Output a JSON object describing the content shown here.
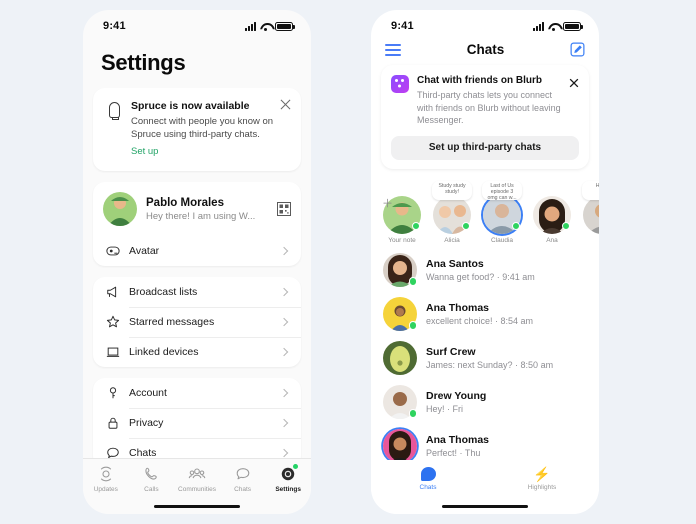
{
  "background_color": "#eef2f7",
  "accent_green": "#21a366",
  "accent_blue": "#3b7ff5",
  "online_green": "#2fd35f",
  "left_phone": {
    "status_bar": {
      "time": "9:41",
      "signal_icon": "cellular-signal-icon",
      "wifi_icon": "wifi-icon",
      "battery_icon": "battery-full-icon"
    },
    "page_title": "Settings",
    "promo_card": {
      "icon": "lightbulb-icon",
      "title": "Spruce is now available",
      "description": "Connect with people you know on Spruce using third-party chats.",
      "link_label": "Set up",
      "close_icon": "close-icon"
    },
    "profile": {
      "name": "Pablo Morales",
      "status": "Hey there! I am using W...",
      "avatar": "profile-avatar",
      "qr_icon": "qr-code-icon"
    },
    "avatar_row": {
      "label": "Avatar",
      "icon": "avatar-icon",
      "chevron": "chevron-right-icon"
    },
    "group_one": [
      {
        "label": "Broadcast lists",
        "icon": "megaphone-icon"
      },
      {
        "label": "Starred messages",
        "icon": "star-icon"
      },
      {
        "label": "Linked devices",
        "icon": "laptop-icon"
      }
    ],
    "group_two": [
      {
        "label": "Account",
        "icon": "key-icon"
      },
      {
        "label": "Privacy",
        "icon": "lock-icon"
      },
      {
        "label": "Chats",
        "icon": "chat-bubble-icon"
      }
    ],
    "tabs": [
      {
        "label": "Updates",
        "icon": "updates-icon",
        "active": false,
        "badge": false
      },
      {
        "label": "Calls",
        "icon": "phone-icon",
        "active": false,
        "badge": false
      },
      {
        "label": "Communities",
        "icon": "communities-icon",
        "active": false,
        "badge": false
      },
      {
        "label": "Chats",
        "icon": "chats-icon",
        "active": false,
        "badge": false
      },
      {
        "label": "Settings",
        "icon": "settings-icon",
        "active": true,
        "badge": true
      }
    ]
  },
  "right_phone": {
    "status_bar": {
      "time": "9:41",
      "signal_icon": "cellular-signal-icon",
      "wifi_icon": "wifi-icon",
      "battery_icon": "battery-full-icon"
    },
    "header": {
      "menu_icon": "hamburger-menu-icon",
      "title": "Chats",
      "compose_icon": "compose-icon"
    },
    "blurb_card": {
      "icon": "blurb-app-icon",
      "title": "Chat with friends on Blurb",
      "description": "Third-party chats lets you connect with friends on Blurb without leaving Messenger.",
      "button_label": "Set up third-party chats",
      "close_icon": "close-icon"
    },
    "stories": [
      {
        "name": "Your note",
        "note": "",
        "add": true,
        "ring": false,
        "online": true
      },
      {
        "name": "Alicia",
        "note": "Study study study!",
        "add": false,
        "ring": false,
        "online": true
      },
      {
        "name": "Claudia",
        "note": "Last of Us episode 3 omg can w...",
        "add": false,
        "ring": true,
        "online": true
      },
      {
        "name": "Ana",
        "note": "",
        "add": false,
        "ring": false,
        "online": true
      },
      {
        "name": "Br",
        "note": "Hang",
        "add": false,
        "ring": false,
        "online": true
      }
    ],
    "chats": [
      {
        "name": "Ana Santos",
        "snippet": "Wanna get food? · 9:41 am",
        "online": true,
        "ring": false
      },
      {
        "name": "Ana Thomas",
        "snippet": "excellent choice! · 8:54 am",
        "online": true,
        "ring": false
      },
      {
        "name": "Surf Crew",
        "snippet": "James: next Sunday? · 8:50 am",
        "online": false,
        "ring": false
      },
      {
        "name": "Drew Young",
        "snippet": "Hey! · Fri",
        "online": true,
        "ring": false
      },
      {
        "name": "Ana Thomas",
        "snippet": "Perfect! · Thu",
        "online": false,
        "ring": true
      }
    ],
    "tabs": [
      {
        "label": "Chats",
        "icon": "chats-bubble-icon",
        "active": true
      },
      {
        "label": "Highlights",
        "icon": "lightning-bolt-icon",
        "active": false
      }
    ]
  }
}
